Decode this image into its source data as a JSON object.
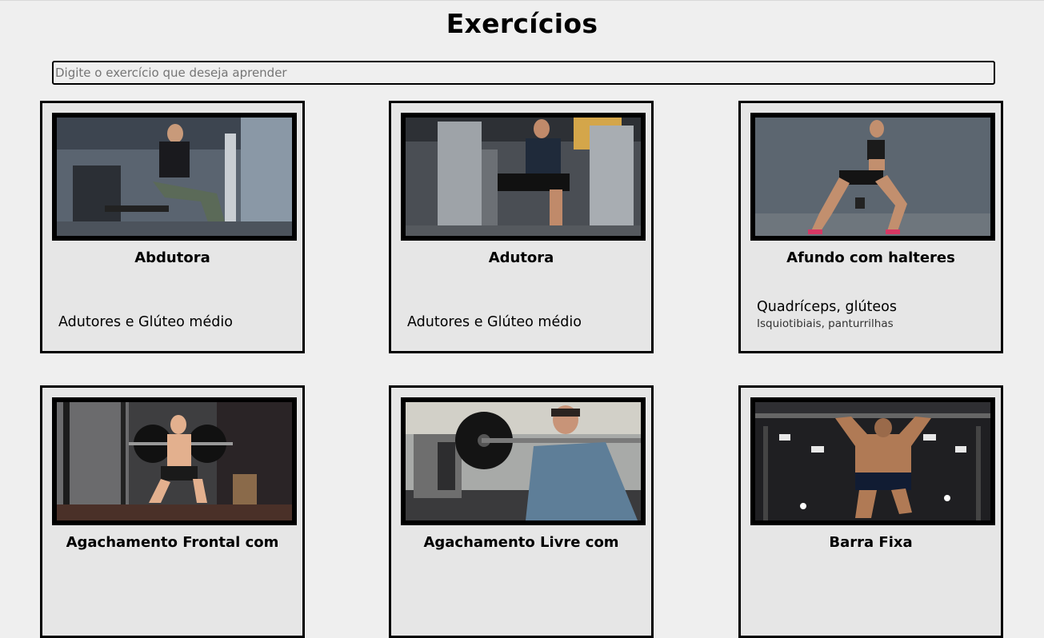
{
  "page": {
    "title": "Exercícios"
  },
  "search": {
    "placeholder": "Digite o exercício que deseja aprender"
  },
  "cards": [
    {
      "name": "Abdutora",
      "primary": "Adutores e Glúteo médio",
      "secondary": ""
    },
    {
      "name": "Adutora",
      "primary": "Adutores e Glúteo médio",
      "secondary": ""
    },
    {
      "name": "Afundo com halteres",
      "primary": "Quadríceps, glúteos",
      "secondary": "Isquiotibiais, panturrilhas"
    },
    {
      "name": "Agachamento Frontal com",
      "primary": "",
      "secondary": ""
    },
    {
      "name": "Agachamento Livre com",
      "primary": "",
      "secondary": ""
    },
    {
      "name": "Barra Fixa",
      "primary": "",
      "secondary": ""
    }
  ]
}
